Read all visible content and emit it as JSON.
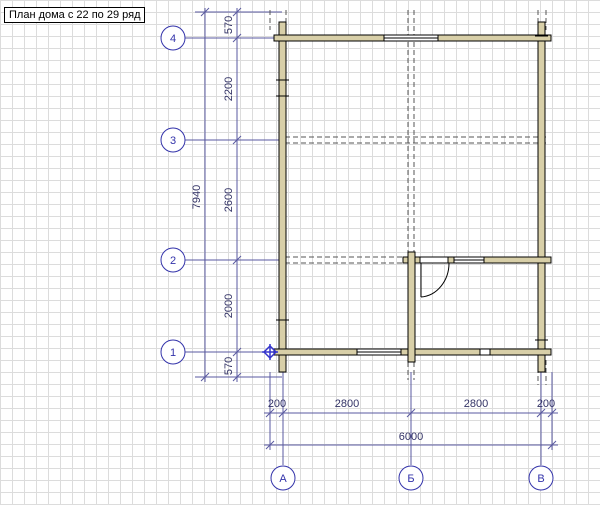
{
  "title": "План дома с 22 по 29 ряд",
  "colors": {
    "grid": "#dcdcdc",
    "axis": "#3333aa",
    "dimension": "#5a5aa0",
    "wall": "#d8cfa8",
    "outline": "#000000"
  },
  "icons": {
    "origin_marker": "move-crosshair-icon"
  },
  "axes_rows": [
    {
      "label": "4"
    },
    {
      "label": "3"
    },
    {
      "label": "2"
    },
    {
      "label": "1"
    }
  ],
  "axes_cols": [
    {
      "label": "А"
    },
    {
      "label": "Б"
    },
    {
      "label": "В"
    }
  ],
  "dims_vertical": {
    "outer_total": "7940",
    "segments": [
      "570",
      "2200",
      "2600",
      "2000",
      "570"
    ]
  },
  "dims_horizontal": {
    "segments": [
      "200",
      "2800",
      "2800",
      "200"
    ],
    "total": "6000"
  }
}
